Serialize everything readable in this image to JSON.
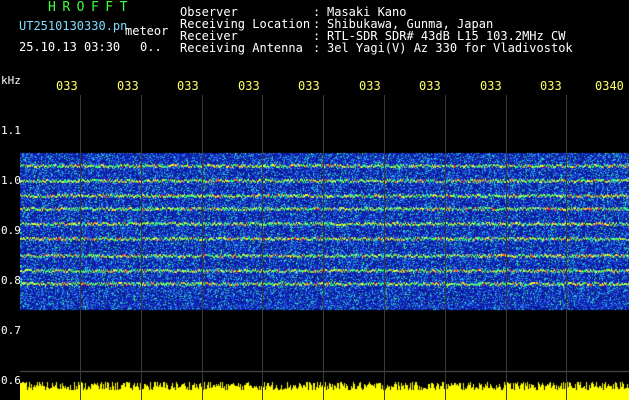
{
  "header": {
    "app_title": "HROFFT",
    "filename": "UT2510130330.pn",
    "tag": "meteor",
    "datetime": "25.10.13 03:30",
    "counter": "0..",
    "info": [
      {
        "label": "Observer",
        "value": "Masaki Kano"
      },
      {
        "label": "Receiving Location",
        "value": "Shibukawa, Gunma, Japan"
      },
      {
        "label": "Receiver",
        "value": "RTL-SDR SDR# 43dB L15 103.2MHz CW"
      },
      {
        "label": "Receiving Antenna",
        "value": "3el Yagi(V) Az 330 for Vladivostok"
      }
    ],
    "separator": ":"
  },
  "axis": {
    "unit": "kHz",
    "x_ticks": [
      "033",
      "033",
      "033",
      "033",
      "033",
      "033",
      "033",
      "033",
      "033",
      "0340"
    ],
    "y_ticks": [
      "1.1",
      "1.0",
      "0.9",
      "0.8",
      "0.7",
      "0.6"
    ]
  },
  "colors": {
    "background": "#000000",
    "title_green": "#3cff3c",
    "header_text": "#ffffff",
    "tick_yellow": "#ffff66",
    "signal_band": "#ffff00",
    "noise_blue": "#1a2fd0"
  }
}
